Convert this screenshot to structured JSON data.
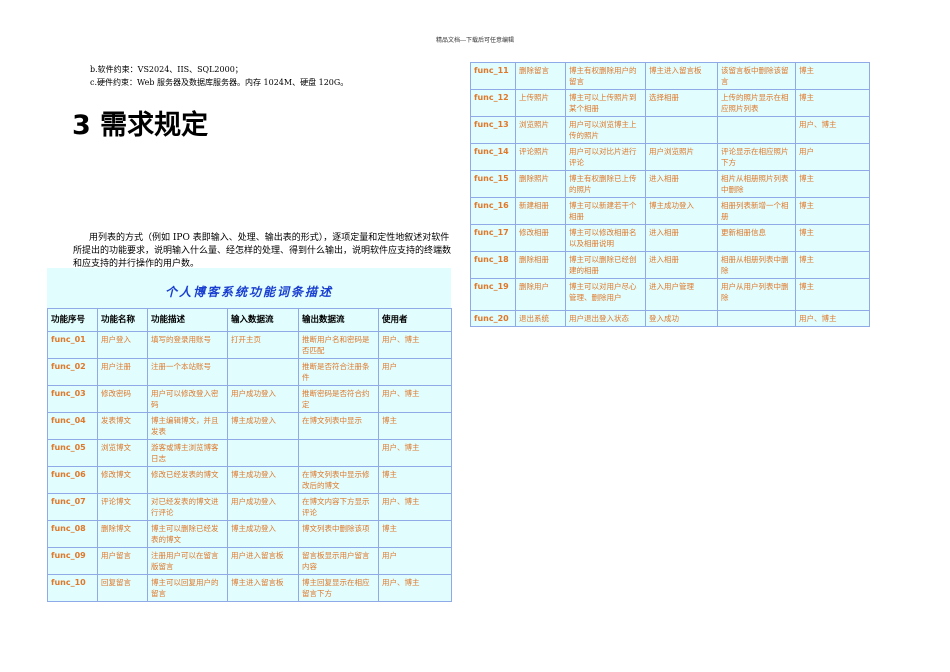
{
  "header": "精品文档---下载后可任意编辑",
  "constraints": [
    "b.软件约束：VS2024、IIS、SQL2000；",
    "c.硬件约束：Web 服务器及数据库服务器。内存 1024M、硬盘 120G。"
  ],
  "heading": "3 需求规定",
  "paragraph": "用列表的方式（例如 IPO 表即输入、处理、输出表的形式），逐项定量和定性地叙述对软件所提出的功能要求，说明输入什么量、经怎样的处理、得到什么输出，说明软件应支持的终端数和应支持的并行操作的用户数。",
  "table": {
    "title": "个人博客系统功能词条描述",
    "columns": [
      "功能序号",
      "功能名称",
      "功能描述",
      "输入数据流",
      "输出数据流",
      "使用者"
    ],
    "rows": [
      [
        "func_01",
        "用户登入",
        "填写的登录用账号",
        "打开主页",
        "推断用户名和密码是否匹配",
        "用户、博主"
      ],
      [
        "func_02",
        "用户注册",
        "注册一个本站账号",
        "",
        "推断是否符合注册条件",
        "用户"
      ],
      [
        "func_03",
        "修改密码",
        "用户可以修改登入密码",
        "用户成功登入",
        "推断密码是否符合约定",
        "用户、博主"
      ],
      [
        "func_04",
        "发表博文",
        "博主编辑博文，并且发表",
        "博主成功登入",
        "在博文列表中显示",
        "博主"
      ],
      [
        "func_05",
        "浏览博文",
        "游客或博主浏览博客日志",
        "",
        "",
        "用户、博主"
      ],
      [
        "func_06",
        "修改博文",
        "修改已经发表的博文",
        "博主成功登入",
        "在博文列表中显示修改后的博文",
        "博主"
      ],
      [
        "func_07",
        "评论博文",
        "对已经发表的博文进行评论",
        "用户成功登入",
        "在博文内容下方显示评论",
        "用户、博主"
      ],
      [
        "func_08",
        "删除博文",
        "博主可以删除已经发表的博文",
        "博主成功登入",
        "博文列表中删除该项",
        "博主"
      ],
      [
        "func_09",
        "用户留言",
        "注册用户可以在留言版留言",
        "用户进入留言板",
        "留言板显示用户留言内容",
        "用户"
      ],
      [
        "func_10",
        "回复留言",
        "博主可以回复用户的留言",
        "博主进入留言板",
        "博主回复显示在相应留言下方",
        "用户、博主"
      ],
      [
        "func_11",
        "删除留言",
        "博主有权删除用户的留言",
        "博主进入留言板",
        "该留言板中删除该留言",
        "博主"
      ],
      [
        "func_12",
        "上传照片",
        "博主可以上传照片到某个相册",
        "选择相册",
        "上传的照片显示在相应照片列表",
        "博主"
      ],
      [
        "func_13",
        "浏览照片",
        "用户可以浏览博主上传的照片",
        "",
        "",
        "用户、博主"
      ],
      [
        "func_14",
        "评论照片",
        "用户可以对比片进行评论",
        "用户浏览照片",
        "评论显示在相应照片下方",
        "用户"
      ],
      [
        "func_15",
        "删除照片",
        "博主有权删除已上传的照片",
        "进入相册",
        "相片从相册照片列表中删除",
        "博主"
      ],
      [
        "func_16",
        "新建相册",
        "博主可以新建若干个相册",
        "博主成功登入",
        "相册列表新增一个相册",
        "博主"
      ],
      [
        "func_17",
        "修改相册",
        "博主可以修改相册名以及相册说明",
        "进入相册",
        "更新相册信息",
        "博主"
      ],
      [
        "func_18",
        "删除相册",
        "博主可以删除已经创建的相册",
        "进入相册",
        "相册从相册列表中删除",
        "博主"
      ],
      [
        "func_19",
        "删除用户",
        "博主可以对用户尽心管理、删除用户",
        "进入用户管理",
        "用户从用户列表中删除",
        "博主"
      ],
      [
        "func_20",
        "退出系统",
        "用户退出登入状态",
        "登入成功",
        "",
        "用户、博主"
      ]
    ]
  }
}
